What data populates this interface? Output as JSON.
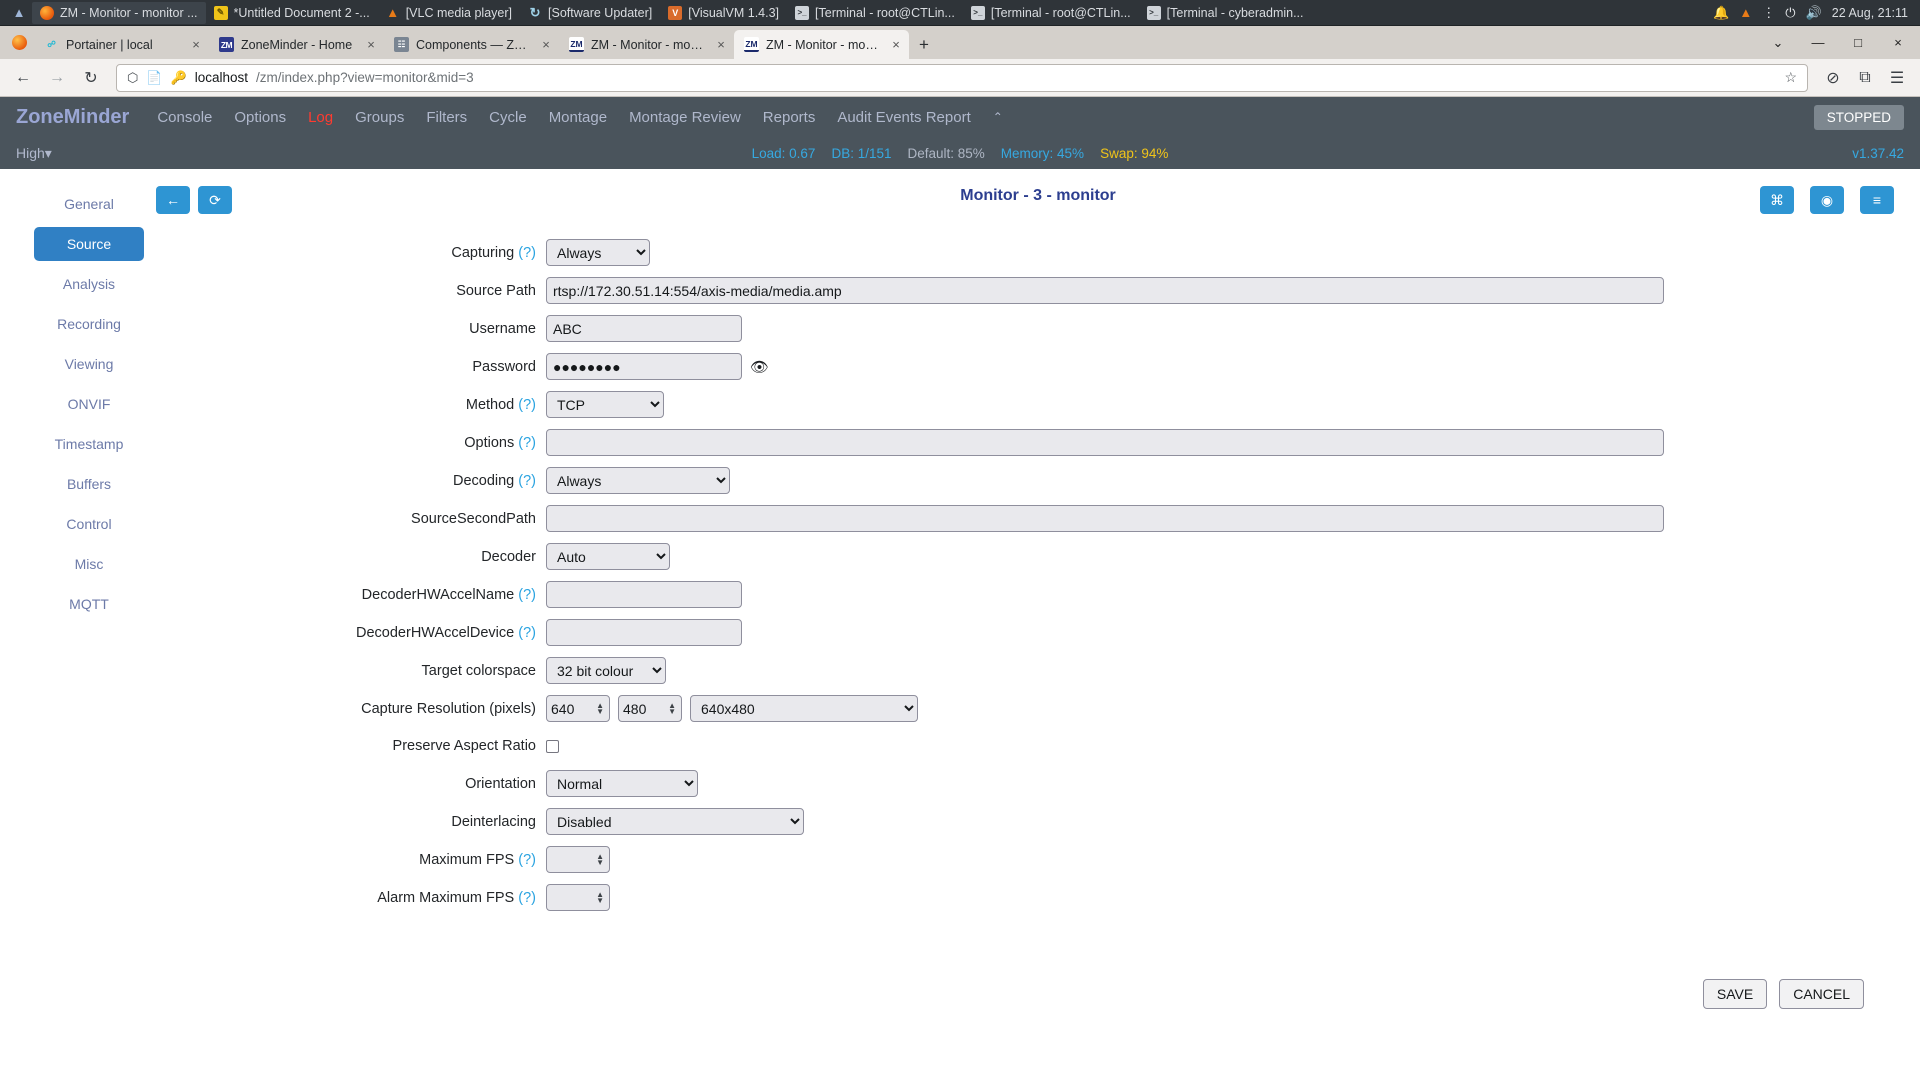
{
  "taskbar": {
    "tasks": [
      {
        "label": "ZM - Monitor - monitor ...",
        "icon": "firefox-icon",
        "active": true
      },
      {
        "label": "*Untitled Document 2 -...",
        "icon": "text-editor-icon",
        "active": false
      },
      {
        "label": "[VLC media player]",
        "icon": "vlc-icon",
        "active": false
      },
      {
        "label": "[Software Updater]",
        "icon": "software-updater-icon",
        "active": false
      },
      {
        "label": "[VisualVM 1.4.3]",
        "icon": "visualvm-icon",
        "active": false
      },
      {
        "label": "[Terminal - root@CTLin...",
        "icon": "terminal-icon",
        "active": false
      },
      {
        "label": "[Terminal - root@CTLin...",
        "icon": "terminal-icon",
        "active": false
      },
      {
        "label": "[Terminal - cyberadmin...",
        "icon": "terminal-icon",
        "active": false
      }
    ],
    "tray": [
      "bell-icon",
      "vlc-cone-icon",
      "network-icon",
      "power-icon",
      "volume-icon"
    ],
    "clock": "22 Aug, 21:11"
  },
  "browser": {
    "tabs": [
      {
        "title": "Portainer | local",
        "favicon": "portainer-icon",
        "active": false
      },
      {
        "title": "ZoneMinder - Home",
        "favicon": "zoneminder-icon",
        "active": false
      },
      {
        "title": "Components — ZoneMin…",
        "favicon": "components-icon",
        "active": false
      },
      {
        "title": "ZM - Monitor - monitor",
        "favicon": "zoneminder-icon",
        "active": false
      },
      {
        "title": "ZM - Monitor - monitor",
        "favicon": "zoneminder-icon",
        "active": true
      }
    ],
    "new_tab_label": "+",
    "close_label": "×",
    "window_controls": {
      "list": "⌄",
      "minimize": "—",
      "maximize": "□",
      "close": "×"
    },
    "nav": {
      "back": "←",
      "forward": "→",
      "reload": "↻"
    },
    "url": {
      "host": "localhost",
      "path": "/zm/index.php?view=monitor&mid=3"
    },
    "url_icons": {
      "shield": "shield-icon",
      "page": "page-icon",
      "key": "key-icon",
      "bookmark": "star-icon"
    },
    "toolbar_right": {
      "save_to_pocket": "⊘",
      "extensions": "⧉",
      "menu": "☰"
    }
  },
  "zoneminder": {
    "brand": "ZoneMinder",
    "nav": [
      {
        "label": "Console",
        "highlight": false
      },
      {
        "label": "Options",
        "highlight": false
      },
      {
        "label": "Log",
        "highlight": true
      },
      {
        "label": "Groups",
        "highlight": false
      },
      {
        "label": "Filters",
        "highlight": false
      },
      {
        "label": "Cycle",
        "highlight": false
      },
      {
        "label": "Montage",
        "highlight": false
      },
      {
        "label": "Montage Review",
        "highlight": false
      },
      {
        "label": "Reports",
        "highlight": false
      },
      {
        "label": "Audit Events Report",
        "highlight": false
      }
    ],
    "nav_caret": "⌃",
    "status_badge": "STOPPED",
    "bandwidth": "High",
    "bandwidth_caret": "▾",
    "stats": {
      "load": "Load: 0.67",
      "db": "DB: 1/151",
      "default": "Default: 85%",
      "memory": "Memory: 45%",
      "swap": "Swap: 94%"
    },
    "version": "v1.37.42"
  },
  "sidebar": {
    "items": [
      {
        "label": "General",
        "active": false
      },
      {
        "label": "Source",
        "active": true
      },
      {
        "label": "Analysis",
        "active": false
      },
      {
        "label": "Recording",
        "active": false
      },
      {
        "label": "Viewing",
        "active": false
      },
      {
        "label": "ONVIF",
        "active": false
      },
      {
        "label": "Timestamp",
        "active": false
      },
      {
        "label": "Buffers",
        "active": false
      },
      {
        "label": "Control",
        "active": false
      },
      {
        "label": "Misc",
        "active": false
      },
      {
        "label": "MQTT",
        "active": false
      }
    ]
  },
  "toolbar": {
    "back_icon": "←",
    "refresh_icon": "⟳",
    "rss_icon": "⌘",
    "feed_icon": "◉",
    "list_icon": "≡"
  },
  "page_title": "Monitor - 3 - monitor",
  "form": {
    "capturing": {
      "label": "Capturing",
      "help": "(?)",
      "value": "Always"
    },
    "source_path": {
      "label": "Source Path",
      "value": "rtsp://172.30.51.14:554/axis-media/media.amp"
    },
    "username": {
      "label": "Username",
      "value": "ABC"
    },
    "password": {
      "label": "Password",
      "value": "●●●●●●●●",
      "reveal_icon": "eye-icon"
    },
    "method": {
      "label": "Method",
      "help": "(?)",
      "value": "TCP"
    },
    "options": {
      "label": "Options",
      "help": "(?)",
      "value": ""
    },
    "decoding": {
      "label": "Decoding",
      "help": "(?)",
      "value": "Always"
    },
    "source_second_path": {
      "label": "SourceSecondPath",
      "value": ""
    },
    "decoder": {
      "label": "Decoder",
      "value": "Auto"
    },
    "decoder_hwaccel_name": {
      "label": "DecoderHWAccelName",
      "help": "(?)",
      "value": ""
    },
    "decoder_hwaccel_device": {
      "label": "DecoderHWAccelDevice",
      "help": "(?)",
      "value": ""
    },
    "target_colorspace": {
      "label": "Target colorspace",
      "value": "32 bit colour"
    },
    "capture_resolution": {
      "label": "Capture Resolution (pixels)",
      "width": "640",
      "height": "480",
      "preset": "640x480"
    },
    "preserve_aspect_ratio": {
      "label": "Preserve Aspect Ratio",
      "checked": false
    },
    "orientation": {
      "label": "Orientation",
      "value": "Normal"
    },
    "deinterlacing": {
      "label": "Deinterlacing",
      "value": "Disabled"
    },
    "maximum_fps": {
      "label": "Maximum FPS",
      "help": "(?)",
      "value": ""
    },
    "alarm_maximum_fps": {
      "label": "Alarm Maximum FPS",
      "help": "(?)",
      "value": ""
    }
  },
  "footer": {
    "save": "SAVE",
    "cancel": "CANCEL"
  }
}
